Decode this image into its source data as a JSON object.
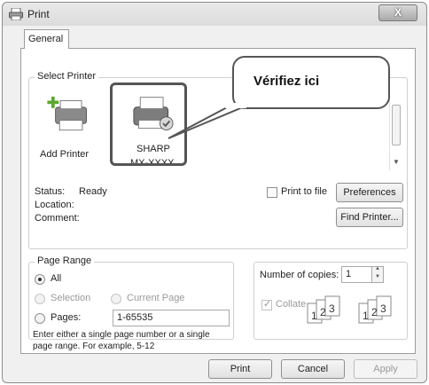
{
  "window": {
    "title": "Print",
    "close_label": "X"
  },
  "tabs": [
    {
      "label": "General"
    }
  ],
  "select_printer": {
    "legend": "Select Printer",
    "printers": [
      {
        "name": "Add Printer"
      },
      {
        "name_line1": "SHARP",
        "name_line2": "MX-XXXX"
      }
    ],
    "status_label": "Status:",
    "status_value": "Ready",
    "location_label": "Location:",
    "location_value": "",
    "comment_label": "Comment:",
    "comment_value": "",
    "print_to_file_label": "Print to file",
    "preferences_label": "Preferences",
    "find_printer_label": "Find Printer..."
  },
  "page_range": {
    "legend": "Page Range",
    "all_label": "All",
    "selection_label": "Selection",
    "current_page_label": "Current Page",
    "pages_label": "Pages:",
    "pages_value": "1-65535",
    "help_line1": "Enter either a single page number or a single",
    "help_line2": "page range.  For example, 5-12"
  },
  "copies": {
    "number_label": "Number of copies:",
    "number_value": "1",
    "collate_label": "Collate"
  },
  "buttons": {
    "print": "Print",
    "cancel": "Cancel",
    "apply": "Apply"
  },
  "annotation": {
    "text": "Vérifiez ici"
  }
}
